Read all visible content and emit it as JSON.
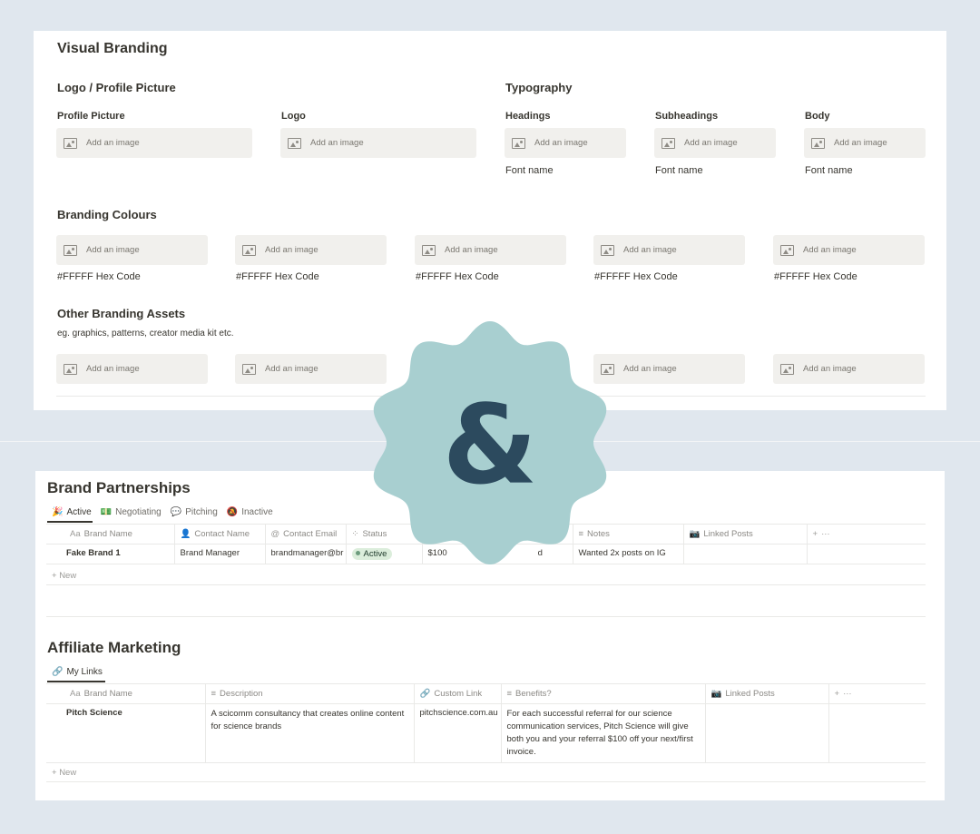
{
  "visual_branding": {
    "title": "Visual Branding",
    "logo_section": {
      "title": "Logo / Profile Picture",
      "profile_picture_label": "Profile Picture",
      "logo_label": "Logo"
    },
    "typography": {
      "title": "Typography",
      "columns": [
        {
          "label": "Headings",
          "font": "Font name"
        },
        {
          "label": "Subheadings",
          "font": "Font name"
        },
        {
          "label": "Body",
          "font": "Font name"
        }
      ]
    },
    "add_image_label": "Add an image",
    "colours": {
      "title": "Branding Colours",
      "hex_labels": [
        "#FFFFF Hex Code",
        "#FFFFF Hex Code",
        "#FFFFF Hex Code",
        "#FFFFF Hex Code",
        "#FFFFF Hex Code"
      ]
    },
    "other_assets": {
      "title": "Other Branding Assets",
      "description": "eg. graphics, patterns, creator media kit etc."
    }
  },
  "stamp": {
    "symbol": "&",
    "fill_color": "#a8cfd0",
    "symbol_color": "#2c4a5e"
  },
  "brand_partnerships": {
    "title": "Brand Partnerships",
    "tabs": [
      {
        "icon": "party-popper-icon",
        "label": "Active"
      },
      {
        "icon": "money-icon",
        "label": "Negotiating"
      },
      {
        "icon": "chat-icon",
        "label": "Pitching"
      },
      {
        "icon": "bell-off-icon",
        "label": "Inactive"
      }
    ],
    "columns": [
      "Brand Name",
      "Contact Name",
      "Contact Email",
      "Status",
      "",
      "Notes",
      "Linked Posts"
    ],
    "row": {
      "brand_name": "Fake Brand 1",
      "contact_name": "Brand Manager",
      "contact_email": "brandmanager@br",
      "status": "Active",
      "amount": "$100",
      "extra": "d",
      "notes": "Wanted 2x posts on IG"
    },
    "new_label": "New"
  },
  "affiliate_marketing": {
    "title": "Affiliate Marketing",
    "tab": "My Links",
    "columns": [
      "Brand Name",
      "Description",
      "Custom Link",
      "Benefits?",
      "Linked Posts"
    ],
    "row": {
      "brand_name": "Pitch Science",
      "description": "A scicomm consultancy that creates online content for science brands",
      "custom_link": "pitchscience.com.au",
      "benefits": "For each successful referral for our science communication services, Pitch Science will give both you and your referral $100 off your next/first invoice."
    },
    "new_label": "New"
  }
}
